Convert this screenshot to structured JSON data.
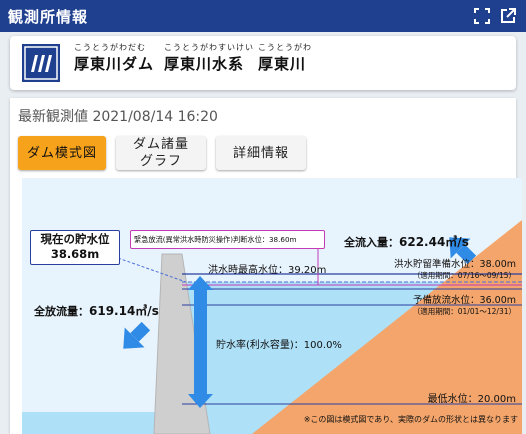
{
  "header": {
    "title": "観測所情報",
    "fullscreen_icon": "fullscreen-icon",
    "external_icon": "open-external-icon"
  },
  "dam": {
    "logo_icon": "dam-logo-icon",
    "dam_ruby": "こうとうがわだむ",
    "dam_name": "厚東川ダム",
    "system_ruby": "こうとうがわすいけい",
    "system_name": "厚東川水系",
    "river_ruby": "こうとうがわ",
    "river_name": "厚東川"
  },
  "observation": {
    "label": "最新観測値",
    "datetime": "2021/08/14 16:20"
  },
  "tabs": [
    {
      "label": "ダム模式図",
      "active": true
    },
    {
      "label": "ダム諸量\nグラフ",
      "active": false
    },
    {
      "label": "詳細情報",
      "active": false
    }
  ],
  "diagram": {
    "current_level_label": "現在の貯水位",
    "current_level_value": "38.68m",
    "emergency_label": "緊急放流(異常洪水時防災操作)判断水位：38.60m",
    "flood_max_label": "洪水時最高水位：39.20m",
    "inflow_label": "全流入量：",
    "inflow_value": "622.44㎥/s",
    "flood_reserve_label": "洪水貯留準備水位：38.00m",
    "flood_reserve_period": "（適用期間：07/16〜09/15）",
    "preliminary_label": "予備放流水位：36.00m",
    "preliminary_period": "（適用期間：01/01〜12/31）",
    "outflow_label": "全放流量：",
    "outflow_value": "619.14㎥/s",
    "storage_rate_label": "貯水率(利水容量)：100.0%",
    "min_level_label": "最低水位：20.00m",
    "note": "※この図は模式図であり、実際のダムの形状とは異なります"
  },
  "colors": {
    "header_bg": "#1f3f8f",
    "active_tab": "#f7a21b",
    "water": "#aee0f7",
    "terrain": "#f3a56b",
    "arrow_blue": "#2f8be6",
    "emergency_box": "#c43bb8"
  }
}
